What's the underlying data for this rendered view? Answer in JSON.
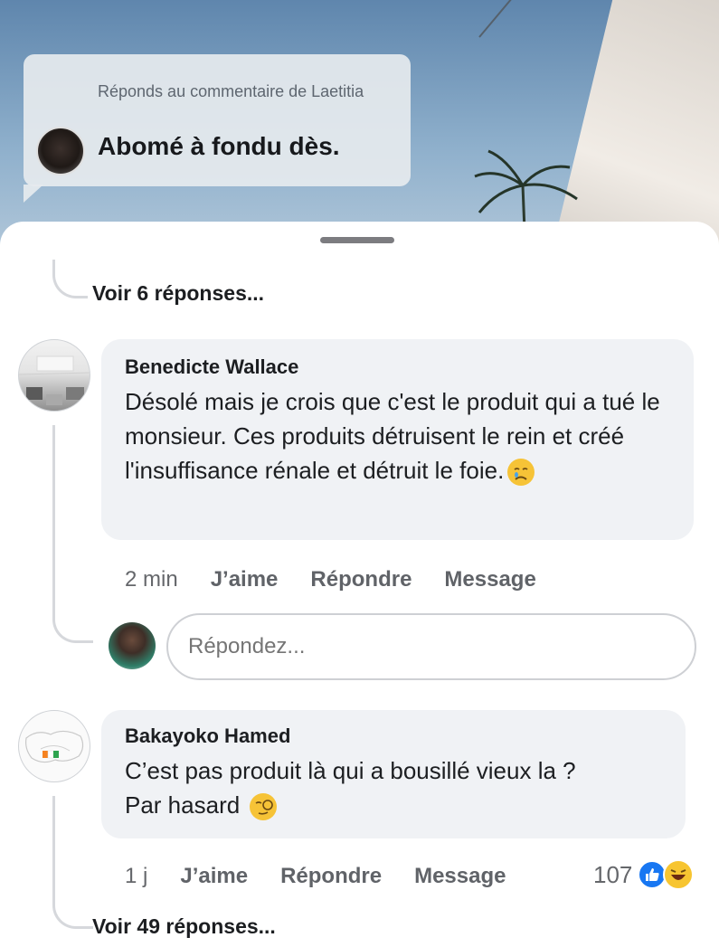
{
  "video": {
    "reply_label": "Réponds au commentaire de Laetitia",
    "quoted_comment": "Abomé à fondu dès."
  },
  "sheet": {
    "view_replies_top": "Voir 6 réponses...",
    "view_replies_bottom": "Voir 49 réponses...",
    "reply_placeholder": "Répondez...",
    "comments": [
      {
        "author": "Benedicte Wallace",
        "text": "Désolé mais je crois que c'est le produit qui a tué le monsieur.  Ces produits détruisent le rein et créé l'insuffisance rénale et détruit le foie.",
        "emoji": "crying-face-emoji",
        "time": "2 min",
        "like": "J’aime",
        "reply": "Répondre",
        "message": "Message"
      },
      {
        "author": "Bakayoko Hamed",
        "text_line1": "C’est pas produit là qui a bousillé vieux la ?",
        "text_line2": "Par hasard",
        "emoji": "face-with-monocle-emoji",
        "time": "1 j",
        "like": "J’aime",
        "reply": "Répondre",
        "message": "Message",
        "reaction_count": "107",
        "reactions": [
          "like-icon",
          "haha-icon"
        ]
      }
    ]
  },
  "colors": {
    "like_blue": "#1877f2",
    "bubble_gray": "#f0f2f5",
    "meta_gray": "#65676b"
  }
}
